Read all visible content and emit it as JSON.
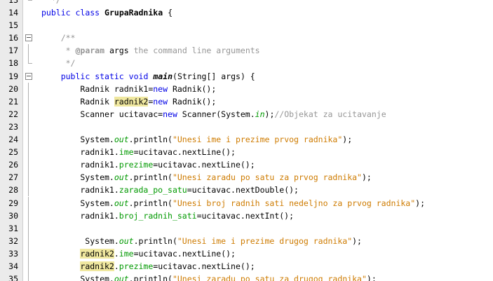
{
  "editor": {
    "lines": [
      {
        "n": "13",
        "code": "  */"
      },
      {
        "n": "14",
        "code": "public class GrupaRadnika {"
      },
      {
        "n": "15",
        "code": ""
      },
      {
        "n": "16",
        "code": "    /**"
      },
      {
        "n": "17",
        "code": "     * @param args the command line arguments"
      },
      {
        "n": "18",
        "code": "     */"
      },
      {
        "n": "19",
        "code": "    public static void main(String[] args) {"
      },
      {
        "n": "20",
        "code": "        Radnik radnik1=new Radnik();"
      },
      {
        "n": "21",
        "code": "        Radnik radnik2=new Radnik();"
      },
      {
        "n": "22",
        "code": "        Scanner ucitavac=new Scanner(System.in);//Objekat za ucitavanje"
      },
      {
        "n": "23",
        "code": ""
      },
      {
        "n": "24",
        "code": "        System.out.println(\"Unesi ime i prezime prvog radnika\");"
      },
      {
        "n": "25",
        "code": "        radnik1.ime=ucitavac.nextLine();"
      },
      {
        "n": "26",
        "code": "        radnik1.prezime=ucitavac.nextLine();"
      },
      {
        "n": "27",
        "code": "        System.out.println(\"Unesi zaradu po satu za prvog radnika\");"
      },
      {
        "n": "28",
        "code": "        radnik1.zarada_po_satu=ucitavac.nextDouble();"
      },
      {
        "n": "29",
        "code": "        System.out.println(\"Unesi broj radnih sati nedeljno za prvog radnika\");"
      },
      {
        "n": "30",
        "code": "        radnik1.broj_radnih_sati=ucitavac.nextInt();"
      },
      {
        "n": "31",
        "code": ""
      },
      {
        "n": "32",
        "code": "         System.out.println(\"Unesi ime i prezime drugog radnika\");"
      },
      {
        "n": "33",
        "code": "        radnik2.ime=ucitavac.nextLine();"
      },
      {
        "n": "34",
        "code": "        radnik2.prezime=ucitavac.nextLine();"
      },
      {
        "n": "35",
        "code": "        System.out.println(\"Unesi zaradu po satu za drugog radnika\");"
      }
    ]
  },
  "colors": {
    "keyword": "#0000e6",
    "comment": "#969696",
    "string": "#ce7b00",
    "field": "#009900",
    "highlight": "#f0e8a0",
    "gutter": "#ebebeb"
  }
}
